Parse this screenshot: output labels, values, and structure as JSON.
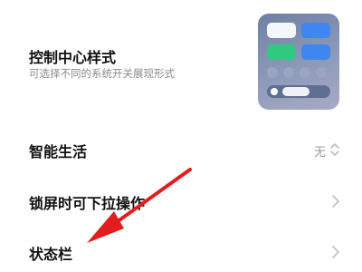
{
  "settings": {
    "control_center_style": {
      "title": "控制中心样式",
      "subtitle": "可选择不同的系统开关展现形式",
      "preview_icon": "control-center-preview-thumbnail"
    },
    "smart_life": {
      "title": "智能生活",
      "value": "无",
      "value_icon": "updown-chevron-icon"
    },
    "lock_screen_pulldown": {
      "title": "锁屏时可下拉操作",
      "nav_icon": "chevron-right-icon"
    },
    "status_bar": {
      "title": "状态栏",
      "nav_icon": "chevron-right-icon"
    }
  },
  "annotation": {
    "arrow_color": "#e11d1d"
  },
  "colors": {
    "tile_blue": "#3f86f0",
    "tile_green": "#2fca7f",
    "tile_white": "#f4f6fb",
    "muted_text": "#8a8a8a",
    "chevron": "#bdbdbd"
  }
}
